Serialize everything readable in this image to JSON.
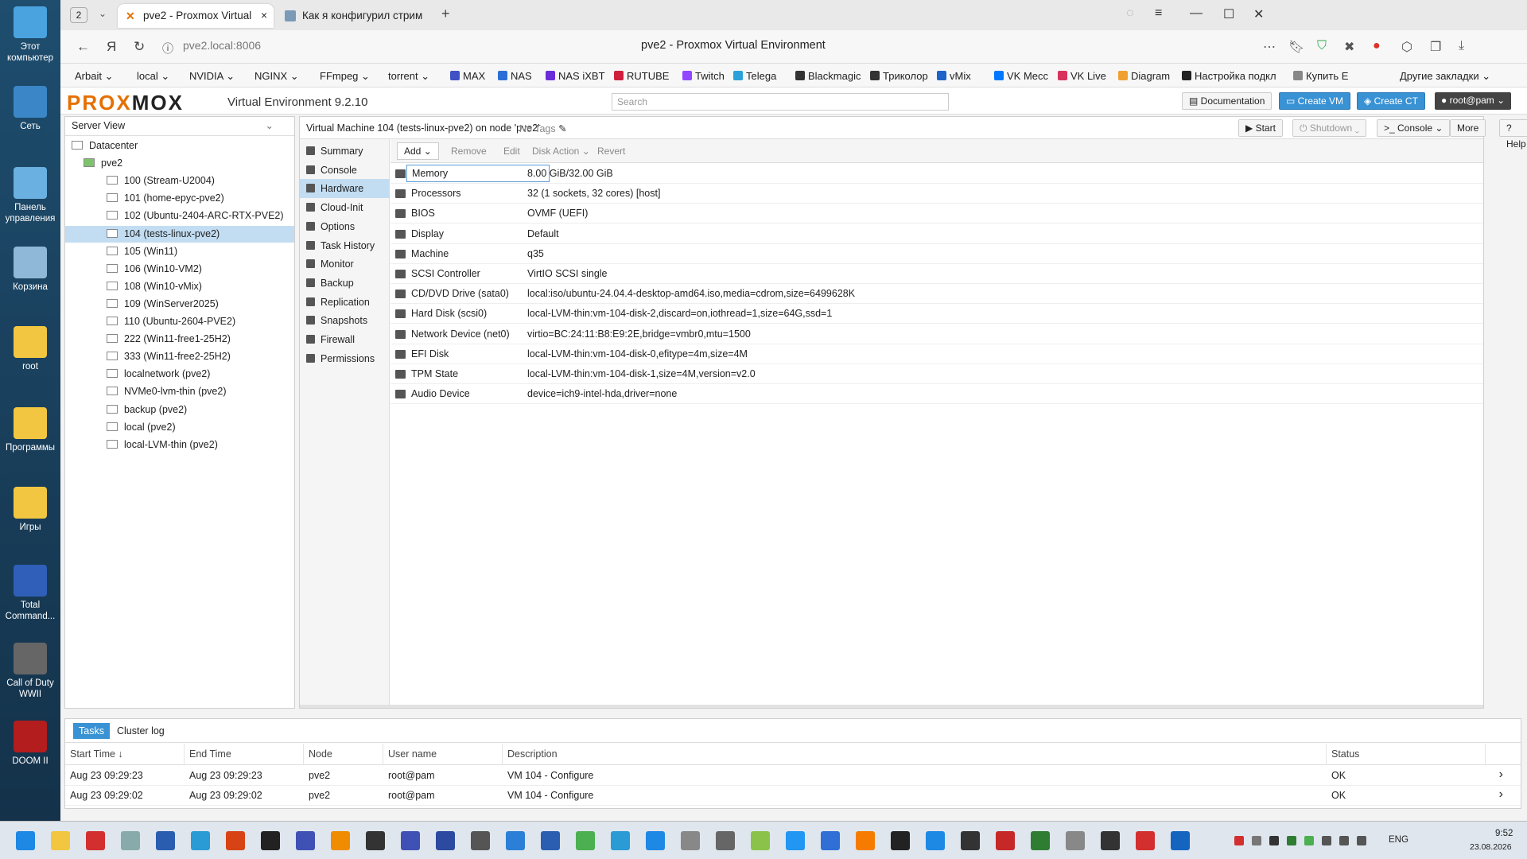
{
  "desktop": {
    "icons": [
      {
        "label": "Этот компьютер",
        "color": "#4aa3df"
      },
      {
        "label": "Сеть",
        "color": "#3b86c6"
      },
      {
        "label": "Панель управления",
        "color": "#6ab0e0"
      },
      {
        "label": "Корзина",
        "color": "#8fb8d8"
      },
      {
        "label": "root",
        "color": "#f2c641"
      },
      {
        "label": "Программы",
        "color": "#f2c641"
      },
      {
        "label": "Игры",
        "color": "#f2c641"
      },
      {
        "label": "Total Command...",
        "color": "#2f5fb8"
      },
      {
        "label": "Call of Duty WWII",
        "color": "#666666"
      },
      {
        "label": "DOOM II",
        "color": "#b31d1d"
      }
    ]
  },
  "browser": {
    "tab_count": "2",
    "tabs": [
      {
        "label": "pve2 - Proxmox Virtual",
        "active": true
      },
      {
        "label": "Как я конфигурил стрим",
        "active": false
      }
    ],
    "url": "pve2.local:8006",
    "page_title": "pve2 - Proxmox Virtual Environment",
    "bookmarks": [
      "Arbait",
      "local",
      "NVIDIA",
      "NGINX",
      "FFmpeg",
      "torrent",
      "MAX",
      "NAS",
      "NAS iXBT",
      "RUTUBE",
      "Twitch",
      "Telega",
      "Blackmagic",
      "Триколор",
      "vMix",
      "VK Mecc",
      "VK Live",
      "Diagram",
      "Настройка подкл",
      "Купить Е",
      "Другие закладки"
    ]
  },
  "pve": {
    "logo_a": "PROX",
    "logo_b": "MOX",
    "version": "Virtual Environment 9.2.10",
    "search_placeholder": "Search",
    "header_buttons": {
      "documentation": "Documentation",
      "create_vm": "Create VM",
      "create_ct": "Create CT",
      "user": "root@pam"
    },
    "view_selector": "Server View",
    "tree": [
      {
        "label": "Datacenter",
        "level": 0
      },
      {
        "label": "pve2",
        "level": 1
      },
      {
        "label": "100 (Stream-U2004)",
        "level": 2
      },
      {
        "label": "101 (home-epyc-pve2)",
        "level": 2
      },
      {
        "label": "102 (Ubuntu-2404-ARC-RTX-PVE2)",
        "level": 2
      },
      {
        "label": "104 (tests-linux-pve2)",
        "level": 2,
        "selected": true
      },
      {
        "label": "105 (Win11)",
        "level": 2
      },
      {
        "label": "106 (Win10-VM2)",
        "level": 2
      },
      {
        "label": "108 (Win10-vMix)",
        "level": 2
      },
      {
        "label": "109 (WinServer2025)",
        "level": 2
      },
      {
        "label": "110 (Ubuntu-2604-PVE2)",
        "level": 2
      },
      {
        "label": "222 (Win11-free1-25H2)",
        "level": 2
      },
      {
        "label": "333 (Win11-free2-25H2)",
        "level": 2
      },
      {
        "label": "localnetwork (pve2)",
        "level": 2
      },
      {
        "label": "NVMe0-lvm-thin (pve2)",
        "level": 2
      },
      {
        "label": "backup (pve2)",
        "level": 2
      },
      {
        "label": "local (pve2)",
        "level": 2
      },
      {
        "label": "local-LVM-thin (pve2)",
        "level": 2
      }
    ],
    "vm_title": "Virtual Machine 104 (tests-linux-pve2) on node 'pve2'",
    "tags": "No Tags",
    "vm_buttons": {
      "start": "Start",
      "shutdown": "Shutdown",
      "console": "Console",
      "more": "More",
      "help": "Help"
    },
    "submenu": [
      "Summary",
      "Console",
      "Hardware",
      "Cloud-Init",
      "Options",
      "Task History",
      "Monitor",
      "Backup",
      "Replication",
      "Snapshots",
      "Firewall",
      "Permissions"
    ],
    "toolbar": {
      "add": "Add",
      "remove": "Remove",
      "edit": "Edit",
      "disk_action": "Disk Action",
      "revert": "Revert"
    },
    "hardware": [
      {
        "key": "Memory",
        "value": "8.00 GiB/32.00 GiB"
      },
      {
        "key": "Processors",
        "value": "32 (1 sockets, 32 cores) [host]"
      },
      {
        "key": "BIOS",
        "value": "OVMF (UEFI)"
      },
      {
        "key": "Display",
        "value": "Default"
      },
      {
        "key": "Machine",
        "value": "q35"
      },
      {
        "key": "SCSI Controller",
        "value": "VirtIO SCSI single"
      },
      {
        "key": "CD/DVD Drive (sata0)",
        "value": "local:iso/ubuntu-24.04.4-desktop-amd64.iso,media=cdrom,size=6499628K"
      },
      {
        "key": "Hard Disk (scsi0)",
        "value": "local-LVM-thin:vm-104-disk-2,discard=on,iothread=1,size=64G,ssd=1"
      },
      {
        "key": "Network Device (net0)",
        "value": "virtio=BC:24:11:B8:E9:2E,bridge=vmbr0,mtu=1500"
      },
      {
        "key": "EFI Disk",
        "value": "local-LVM-thin:vm-104-disk-0,efitype=4m,size=4M"
      },
      {
        "key": "TPM State",
        "value": "local-LVM-thin:vm-104-disk-1,size=4M,version=v2.0"
      },
      {
        "key": "Audio Device",
        "value": "device=ich9-intel-hda,driver=none"
      }
    ],
    "bottom_tabs": [
      "Tasks",
      "Cluster log"
    ],
    "task_columns": [
      "Start Time ↓",
      "End Time",
      "Node",
      "User name",
      "Description",
      "Status"
    ],
    "tasks": [
      {
        "start": "Aug 23 09:29:23",
        "end": "Aug 23 09:29:23",
        "node": "pve2",
        "user": "root@pam",
        "desc": "VM 104 - Configure",
        "status": "OK"
      },
      {
        "start": "Aug 23 09:29:02",
        "end": "Aug 23 09:29:02",
        "node": "pve2",
        "user": "root@pam",
        "desc": "VM 104 - Configure",
        "status": "OK"
      }
    ]
  },
  "taskbar": {
    "lang": "ENG",
    "time": "9:52",
    "date": "23.08.2026"
  }
}
